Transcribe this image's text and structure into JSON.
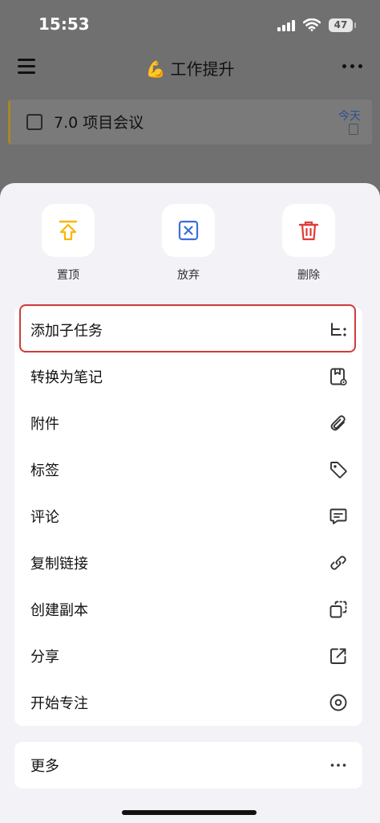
{
  "status": {
    "time": "15:53",
    "battery": "47"
  },
  "nav": {
    "title": "工作提升",
    "emoji": "💪"
  },
  "task": {
    "title": "7.0 项目会议",
    "date": "今天"
  },
  "quick_actions": [
    {
      "label": "置顶",
      "icon": "pin-top-icon",
      "color": "#f5b800"
    },
    {
      "label": "放弃",
      "icon": "abandon-icon",
      "color": "#3a6fd8"
    },
    {
      "label": "删除",
      "icon": "trash-icon",
      "color": "#e03a3a"
    }
  ],
  "menu": [
    {
      "label": "添加子任务",
      "icon": "subtask-icon"
    },
    {
      "label": "转换为笔记",
      "icon": "note-icon"
    },
    {
      "label": "附件",
      "icon": "paperclip-icon"
    },
    {
      "label": "标签",
      "icon": "tag-icon"
    },
    {
      "label": "评论",
      "icon": "comment-icon"
    },
    {
      "label": "复制链接",
      "icon": "link-icon"
    },
    {
      "label": "创建副本",
      "icon": "duplicate-icon"
    },
    {
      "label": "分享",
      "icon": "share-icon"
    },
    {
      "label": "开始专注",
      "icon": "focus-icon"
    }
  ],
  "more": {
    "label": "更多",
    "icon": "more-dots-icon"
  },
  "colors": {
    "highlight": "#d23a3a",
    "sheet_bg": "#f2f2f7"
  }
}
